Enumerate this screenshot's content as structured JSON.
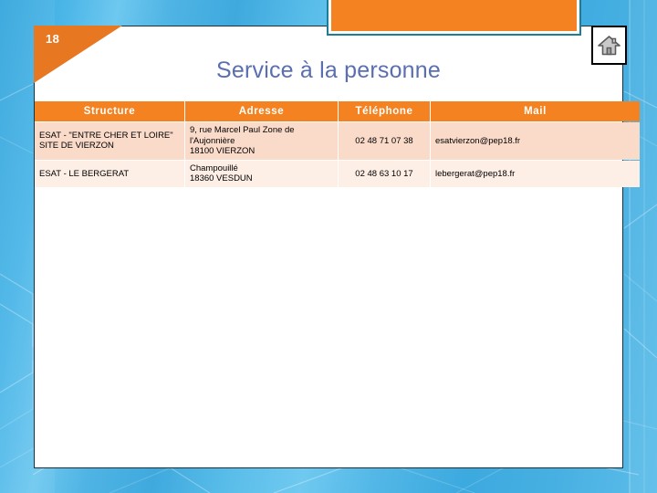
{
  "slide": {
    "number": "18",
    "title": "Service à la personne"
  },
  "home_button": {
    "icon": "home-icon",
    "tooltip": "Accueil"
  },
  "colors": {
    "header_orange": "#f58220",
    "corner_orange": "#e87722",
    "title_blue": "#5a6fb0",
    "row_a": "#fadac9",
    "row_b": "#fdeee6",
    "banner_border_teal": "#1b7e96",
    "background_blue": "#4bb6e8"
  },
  "table": {
    "columns": [
      "Structure",
      "Adresse",
      "Téléphone",
      "Mail"
    ],
    "rows": [
      {
        "structure": "ESAT - \"ENTRE CHER ET LOIRE\" SITE DE VIERZON",
        "adresse": "9, rue Marcel Paul Zone de l'Aujonnière\n18100 VIERZON",
        "telephone": "02 48 71 07 38",
        "mail": "esatvierzon@pep18.fr"
      },
      {
        "structure": "ESAT - LE BERGERAT",
        "adresse": "Champouillé\n18360 VESDUN",
        "telephone": "02 48 63 10 17",
        "mail": "lebergerat@pep18.fr"
      }
    ]
  }
}
